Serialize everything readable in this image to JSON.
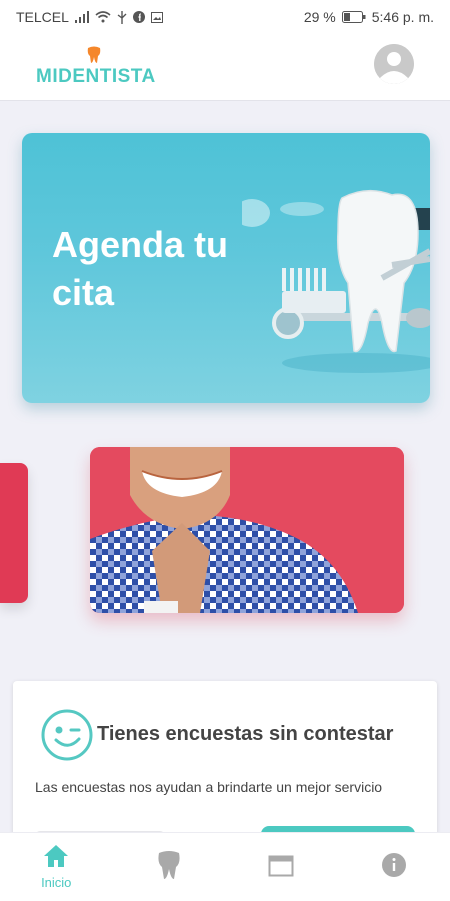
{
  "status_bar": {
    "carrier": "TELCEL",
    "battery": "29 %",
    "time": "5:46 p. m."
  },
  "header": {
    "app_name": "MIDENTISTA",
    "brand_color": "#4cc9c1",
    "logo_icon": "tooth-icon",
    "avatar_icon": "user-avatar-icon"
  },
  "banner": {
    "title": "Agenda tu cita"
  },
  "carousel": {
    "prev_color": "#e03a55",
    "card_color": "#e44a5f"
  },
  "survey": {
    "icon": "wink-face-icon",
    "title": "Tienes encuestas sin contestar",
    "description": "Las encuestas nos ayudan a brindarte un mejor servicio"
  },
  "tabbar": {
    "tabs": [
      {
        "label": "Inicio",
        "icon": "home-icon",
        "active": true
      },
      {
        "label": "",
        "icon": "tooth-icon",
        "active": false
      },
      {
        "label": "",
        "icon": "calendar-icon",
        "active": false
      },
      {
        "label": "",
        "icon": "info-icon",
        "active": false
      }
    ]
  }
}
